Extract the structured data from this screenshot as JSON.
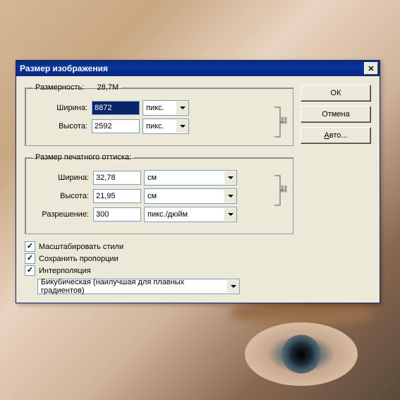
{
  "title": "Размер изображения",
  "buttons": {
    "ok": "ОК",
    "cancel": "Отмена",
    "auto": "Авто..."
  },
  "dimensions": {
    "legend": "Размерность:",
    "size": "28,7M",
    "width_label": "Ширина:",
    "width_value": "8872",
    "width_unit": "пикс.",
    "height_label": "Высота:",
    "height_value": "2592",
    "height_unit": "пикс."
  },
  "print": {
    "legend": "Размер печатного оттиска:",
    "width_label": "Ширина:",
    "width_value": "32,78",
    "width_unit": "см",
    "height_label": "Высота:",
    "height_value": "21,95",
    "height_unit": "см",
    "res_label": "Разрешение:",
    "res_value": "300",
    "res_unit": "пикс./дюйм"
  },
  "checks": {
    "scale_styles": "Масштабировать стили",
    "constrain": "Сохранить пропорции",
    "resample": "Интерполяция"
  },
  "interpolation": "Бикубическая (наилучшая для плавных градиентов)"
}
